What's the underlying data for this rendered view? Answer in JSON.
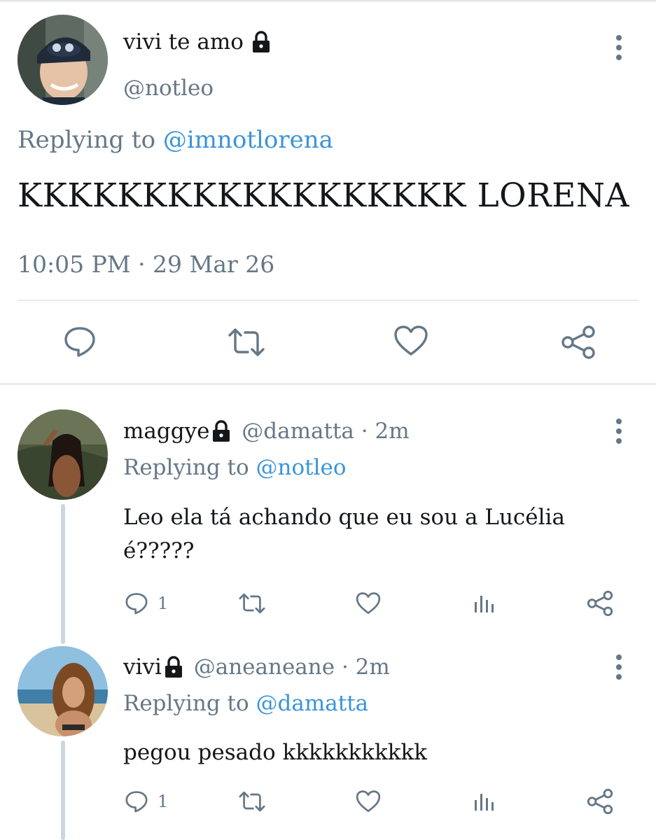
{
  "main_tweet": {
    "display_name": "vivi te amo",
    "handle": "@notleo",
    "replying_prefix": "Replying to",
    "replying_to": "@imnotlorena",
    "text": "KKKKKKKKKKKKKKKKKK LORENA",
    "timestamp": "10:05 PM · 29 Mar 26",
    "actions": [
      "reply-icon",
      "retweet-icon",
      "like-icon",
      "share-icon"
    ]
  },
  "replies": [
    {
      "display_name": "maggye",
      "handle": "@damatta",
      "time": "· 2m",
      "replying_prefix": "Replying to",
      "replying_to": "@notleo",
      "text_line1": "Leo ela tá achando que eu sou a Lucélia",
      "text_line2": "é?????",
      "reply_count": "1"
    },
    {
      "display_name": "vivi",
      "handle": "@aneaneane",
      "time": "· 2m",
      "replying_prefix": "Replying to",
      "replying_to": "@damatta",
      "text_line1": "pegou pesado kkkkkkkkkkk",
      "reply_count": "1"
    }
  ],
  "colors": {
    "text": "#14171a",
    "muted": "#657786",
    "link": "#3b94d9",
    "divider": "#e6ecf0"
  }
}
